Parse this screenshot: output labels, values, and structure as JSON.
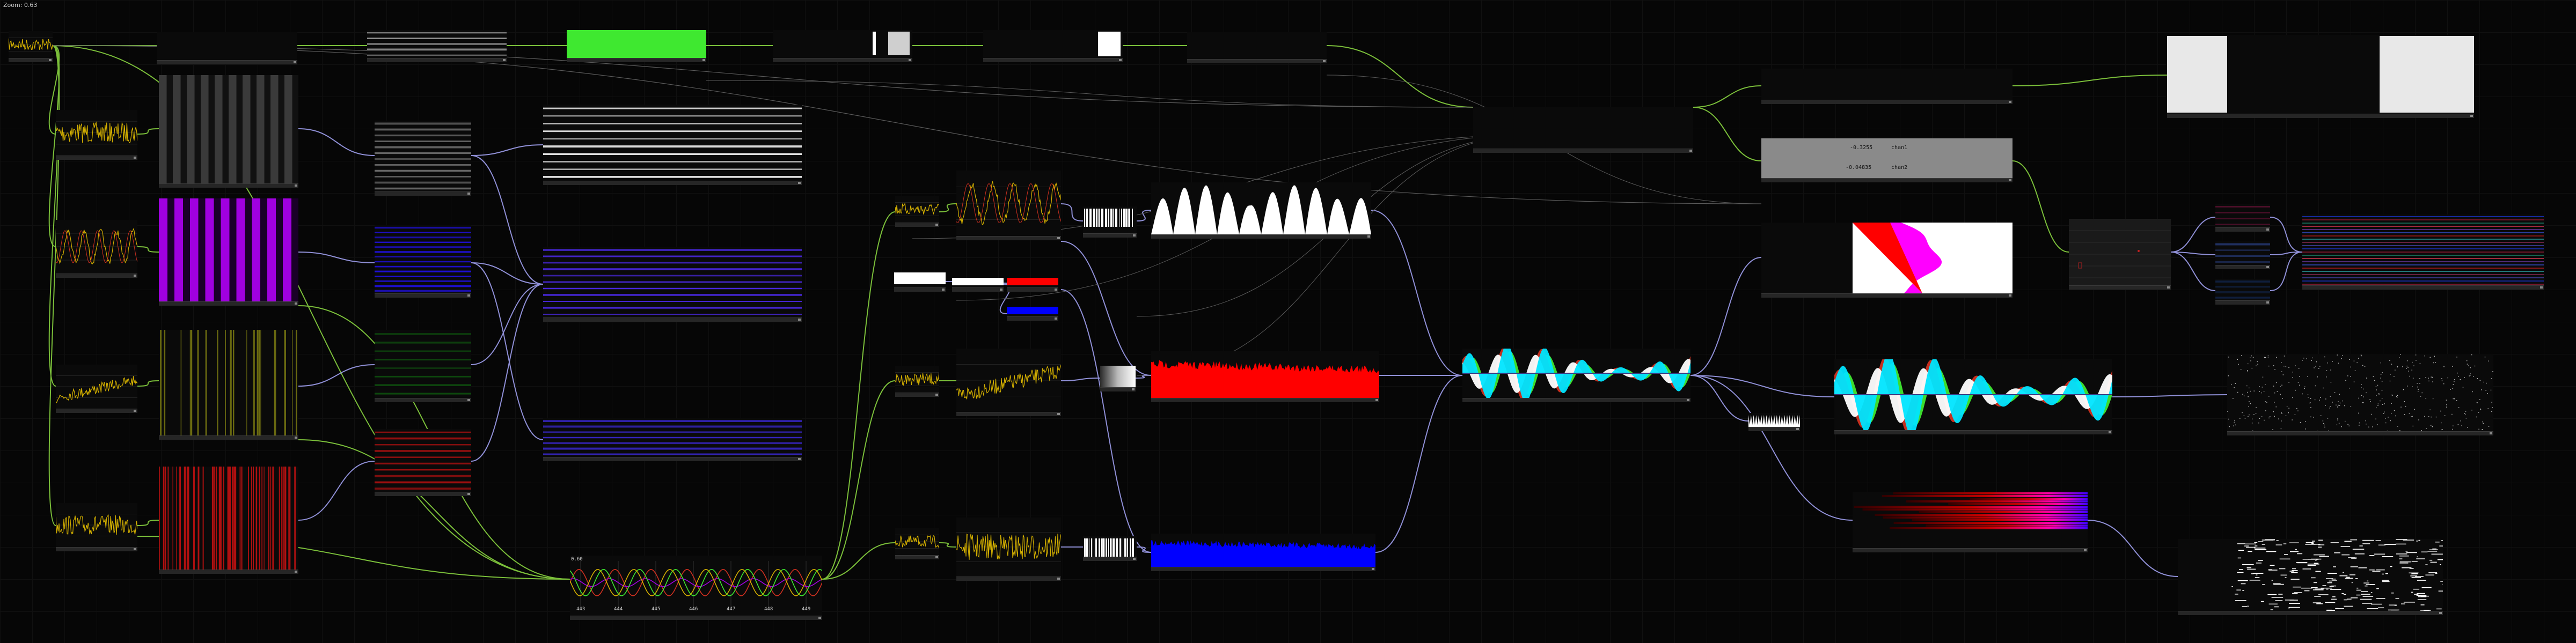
{
  "app": {
    "zoom_label": "Zoom: 0.63"
  },
  "readout": {
    "chan1_value": "-0.3255",
    "chan1_name": "chan1",
    "chan2_value": "-0.04835",
    "chan2_name": "chan2"
  },
  "timeline": {
    "ticks": [
      "443",
      "444",
      "445",
      "446",
      "447",
      "448",
      "449"
    ],
    "max_label": "0.60"
  },
  "colors": {
    "green_wire": "#7bbf3a",
    "blue_wire": "#8f8fd6",
    "grey_wire": "#5a5a5a",
    "signal_yellow": "#d4b000",
    "signal_red": "#d03020",
    "purple": "#a000e0",
    "blue_stripe": "#2010e0",
    "bright_green": "#3fe830",
    "red_fill": "#ff0000",
    "blue_fill": "#0000ff",
    "cyan": "#00e5ff",
    "magenta": "#ff00ff"
  },
  "icons": {
    "node_handle": "square-handle-icon"
  }
}
